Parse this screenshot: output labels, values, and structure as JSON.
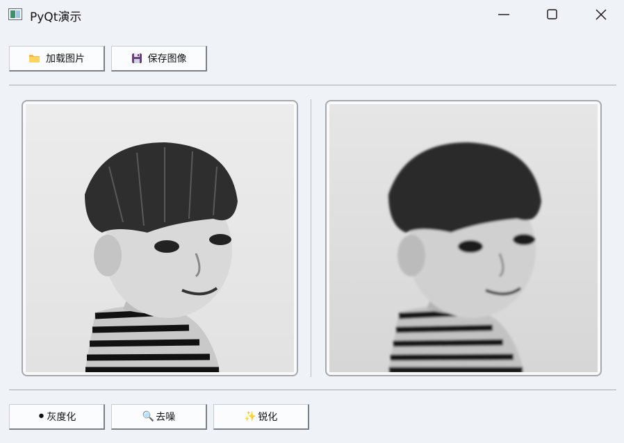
{
  "window": {
    "title": "PyQt演示",
    "minimize_glyph": "minimize-icon",
    "maximize_glyph": "maximize-icon",
    "close_glyph": "close-icon"
  },
  "toolbar": {
    "load_label": "加载图片",
    "load_icon": "folder-icon",
    "save_label": "保存图像",
    "save_icon": "floppy-disk-icon"
  },
  "images": {
    "original_alt": "original-photo",
    "processed_alt": "processed-photo"
  },
  "actions": {
    "grayscale_label": "灰度化",
    "grayscale_icon": "⚫",
    "denoise_label": "去噪",
    "denoise_icon": "🔍",
    "sharpen_label": "锐化",
    "sharpen_icon": "✨"
  },
  "colors": {
    "background": "#eff2f7",
    "button_face": "#fbfcfd",
    "divider": "#a9acb0"
  }
}
